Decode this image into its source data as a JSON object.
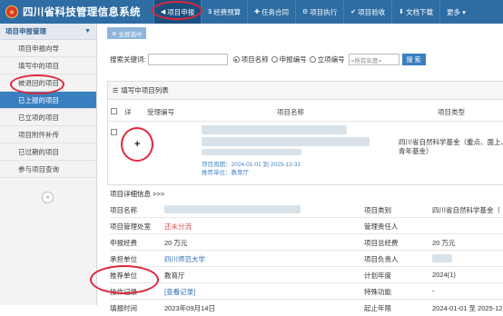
{
  "app": {
    "title": "四川省科技管理信息系统",
    "logo_glyph": "★"
  },
  "topnav": [
    {
      "icon": "◀",
      "label": "项目申报",
      "active": true
    },
    {
      "icon": "$",
      "label": "经费预算"
    },
    {
      "icon": "✚",
      "label": "任务合同"
    },
    {
      "icon": "⚙",
      "label": "项目执行"
    },
    {
      "icon": "✔",
      "label": "项目验收"
    },
    {
      "icon": "⬇",
      "label": "文档下载"
    },
    {
      "icon": "",
      "label": "更多 ▾"
    }
  ],
  "sidebar": {
    "header": "项目申报管理",
    "items": [
      {
        "label": "项目申报向导"
      },
      {
        "label": "填写中的项目"
      },
      {
        "label": "被退回的项目"
      },
      {
        "label": "已上报的项目",
        "active": true
      },
      {
        "label": "已立项的项目"
      },
      {
        "label": "项目附件补传"
      },
      {
        "label": "已过期的项目"
      },
      {
        "label": "参与项目查询"
      }
    ],
    "collapse_glyph": "«"
  },
  "toolbar": {
    "fullscreen_label": "全屏选中"
  },
  "search": {
    "label": "搜索关键词:",
    "value": "",
    "options": [
      "项目名称",
      "申报编号",
      "立项编号"
    ],
    "selected": "项目名称",
    "year_placeholder": "=所有年度=",
    "button": "搜 索"
  },
  "list": {
    "panel_title": "填写中项目列表",
    "columns": [
      "详",
      "受理编号",
      "项目名称",
      "项目类型"
    ],
    "row": {
      "expand": "+",
      "period": "项目周期：2024-01-01 到 2025-12-31",
      "recommender": "推荐单位：教育厅",
      "type": "四川省自然科学基金（重点、面上、青年基金）"
    }
  },
  "detail": {
    "title": "项目详细信息 >>>",
    "rows": [
      {
        "l1": "项目名称",
        "v1": "",
        "l2": "项目类别",
        "v2": "四川省自然科学基金（"
      },
      {
        "l1": "项目管理处室",
        "v1": "还未分流",
        "v1_style": "red",
        "l2": "管理责任人",
        "v2": ""
      },
      {
        "l1": "申报经费",
        "v1": "20 万元",
        "l2": "项目总经费",
        "v2": "20 万元"
      },
      {
        "l1": "承担单位",
        "v1": "四川师范大学",
        "v1_style": "link",
        "l2": "项目负责人",
        "v2": ""
      },
      {
        "l1": "推荐单位",
        "v1": "教育厅",
        "l2": "计划年度",
        "v2": "2024(1)"
      },
      {
        "l1": "操作记录",
        "v1": "[查看记录]",
        "v1_style": "link",
        "l2": "特殊功能",
        "v2": "-"
      },
      {
        "l1": "填报时间",
        "v1": "2023年09月14日",
        "l2": "起止年限",
        "v2": "2024-01-01 至 2025-12"
      }
    ]
  },
  "colors": {
    "topbar": "#2e6da4",
    "sidebar_active": "#3a80c0",
    "annotation": "#e0263a"
  }
}
